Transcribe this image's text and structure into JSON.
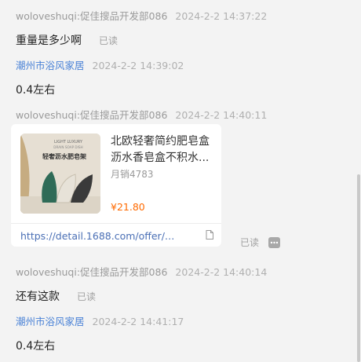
{
  "messages": [
    {
      "sender": "woloveshuqi:促佳搜品开发部086",
      "time": "2024-2-2 14:37:22",
      "text": "重量是多少啊",
      "read": "已读"
    },
    {
      "sender": "潮州市浴风家居",
      "time": "2024-2-2 14:39:02",
      "text": "0.4左右"
    },
    {
      "sender": "woloveshuqi:促佳搜品开发部086",
      "time": "2024-2-2 14:40:11"
    },
    {
      "sender": "woloveshuqi:促佳搜品开发部086",
      "time": "2024-2-2 14:40:14",
      "text": "还有这款",
      "read": "已读"
    },
    {
      "sender": "潮州市浴风家居",
      "time": "2024-2-2 14:41:17",
      "text": "0.4左右"
    }
  ],
  "product_card": {
    "title": "北欧轻奢简约肥皂盒沥水香皂盒不积水...",
    "sales": "月销4783",
    "price": "¥21.80",
    "link": "https://detail.1688.com/offer/70...",
    "read": "已读",
    "image_text_top": "LIGHT LUXURY",
    "image_text_sub": "DRAIN SOAP DISH",
    "image_text_cn": "轻奢沥水肥皂架",
    "doc_icon": "document-icon",
    "more_icon": "more-icon"
  },
  "colors": {
    "accent_blue": "#4a82d6",
    "price_orange": "#ff6a00",
    "background": "#f3f3f3"
  }
}
